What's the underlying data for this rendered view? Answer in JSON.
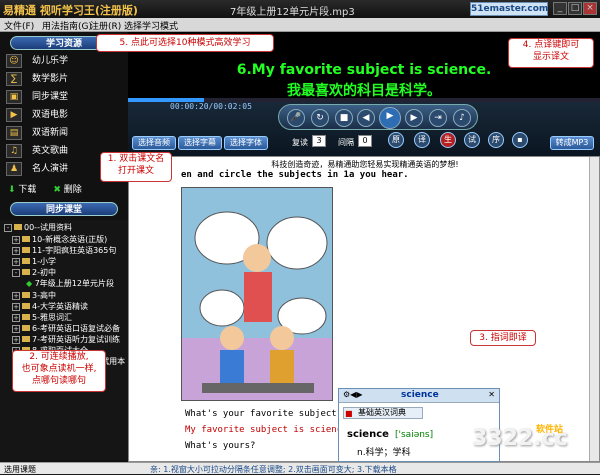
{
  "window": {
    "app_name": "易精通 视听学习王(注册版)",
    "file_title": "7年级上册12单元片段.mp3",
    "brand": "51emaster.com",
    "min": "_",
    "max": "□",
    "close": "×"
  },
  "menu": [
    "文件(F)",
    "用法指南(G)",
    "注册(R)",
    "选择学习模式"
  ],
  "resources": {
    "header": "学习资源",
    "items": [
      "幼儿乐学",
      "数学影片",
      "同步课堂",
      "双语电影",
      "双语新闻",
      "英文歌曲",
      "名人演讲"
    ],
    "download": "下载",
    "delete": "删除"
  },
  "sync": {
    "header": "同步课堂",
    "tree": [
      {
        "label": "00--试用资料",
        "exp": "-"
      },
      {
        "label": "10-新概念英语(正版)",
        "exp": "+"
      },
      {
        "label": "11-宇阳疯狂英语365句",
        "exp": "+"
      },
      {
        "label": "1-小学",
        "exp": "+"
      },
      {
        "label": "2-初中",
        "exp": "-"
      },
      {
        "label": "7年级上册12单元片段",
        "exp": ""
      },
      {
        "label": "3-高中",
        "exp": "+"
      },
      {
        "label": "4-大学英语精读",
        "exp": "+"
      },
      {
        "label": "5-雅思词汇",
        "exp": "+"
      },
      {
        "label": "6-考研英语口语复试必备",
        "exp": "+"
      },
      {
        "label": "7-考研英语听力复试训练",
        "exp": "+"
      },
      {
        "label": "8-求职面试大全",
        "exp": "+"
      },
      {
        "label": "9-新概念英语第1册试用本",
        "exp": "+"
      }
    ]
  },
  "lyric": {
    "english": "6.My favorite subject is science.",
    "chinese": "我最喜欢的科目是科学。"
  },
  "player": {
    "time": "00:00:20/00:02:05",
    "progress": 0.16,
    "select_audio": "选择音频",
    "select_subtitle": "选择字幕",
    "select_font": "选择字体",
    "repeat_label": "复读",
    "repeat_value": "3",
    "interval_label": "间隔",
    "interval_value": "0",
    "btn_yuan": "原",
    "btn_yi": "译",
    "btn_sheng": "生",
    "btn_shi": "试",
    "btn_xu": "序",
    "convert_mp3": "转成MP3"
  },
  "content": {
    "slogan": "科技创造奇迹，易精通助您轻易实现精通英语的梦想!",
    "instruction": "en and circle the subjects in 1a you hear.",
    "q1": "What's your favorite subject?",
    "q2": "My favorite subject is science.",
    "q3": "What's yours?"
  },
  "dict": {
    "word": "science",
    "tab": "基础英汉词典",
    "head": "science",
    "phonetic": "['saiəns]",
    "definition": "n.科学；学科"
  },
  "callouts": {
    "c1": "1. 双击课文名\n打开课文",
    "c2": "2. 可连续播放,\n也可象点读机一样,\n点哪句读哪句",
    "c3": "3. 指词即译",
    "c4": "4. 点译键即可\n显示译文",
    "c5": "5. 点此可选择10种模式高效学习"
  },
  "status": {
    "left": "选用课题",
    "tip": "亲: 1.视窗大小可拉动分隔条任意调整; 2.双击画面可变大; 3.下载本格"
  },
  "watermark": {
    "big": "3322.cc",
    "sub": "软件站"
  },
  "colors": {
    "lyric": "#22ff22",
    "callout": "#cc0000",
    "accent": "#3b6ab1"
  }
}
